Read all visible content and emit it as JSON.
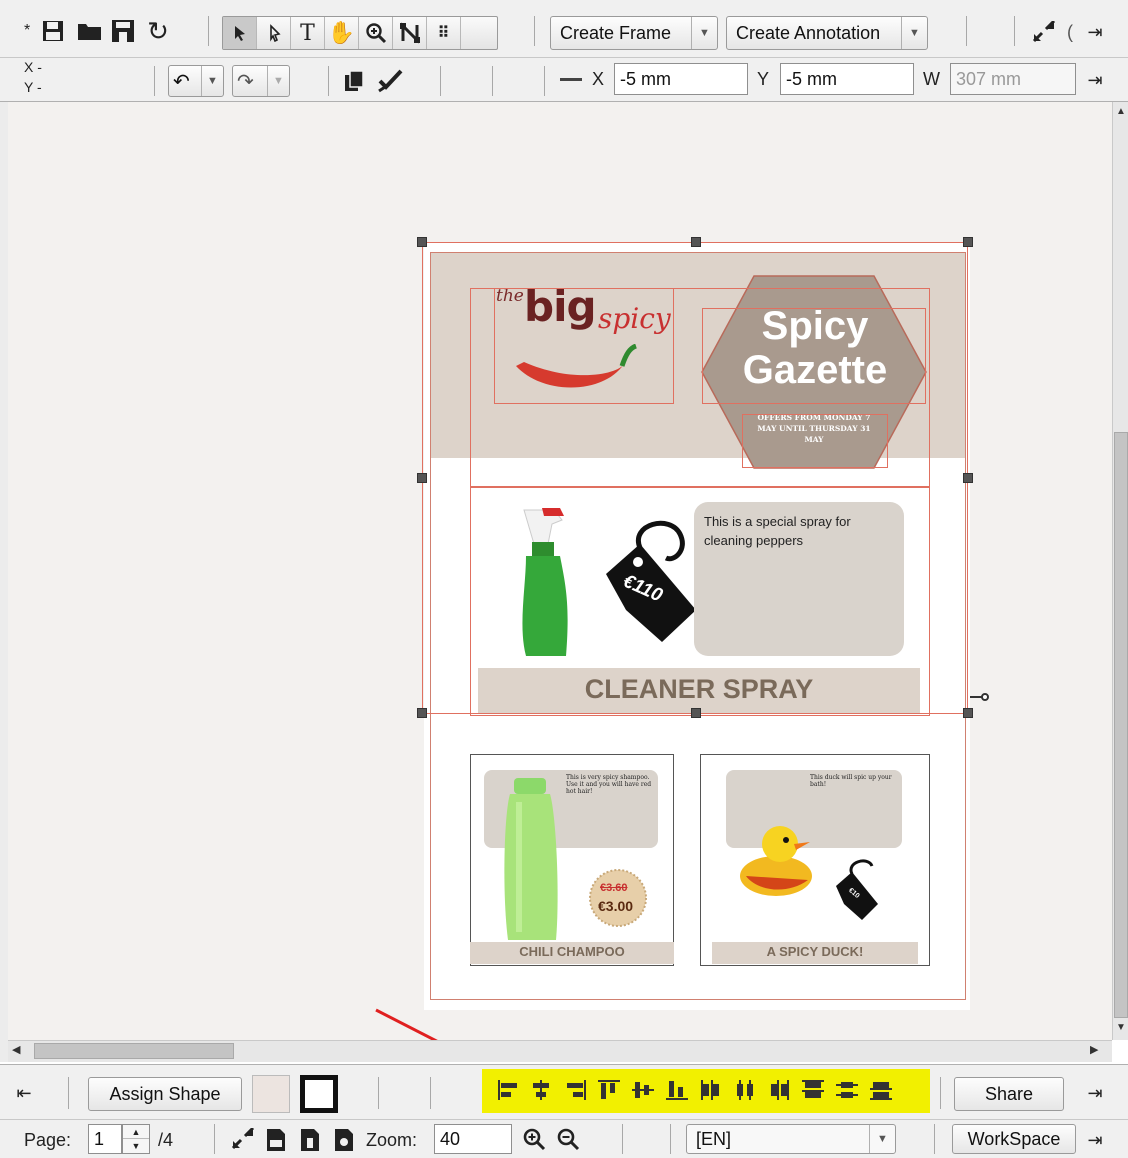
{
  "toolbar_top": {
    "modified_marker": "*",
    "create_frame_label": "Create Frame",
    "create_annotation_label": "Create Annotation"
  },
  "toolbar_props": {
    "x_readout": "X -",
    "y_readout": "Y -",
    "x_label": "X",
    "x_value": "-5 mm",
    "y_label": "Y",
    "y_value": "-5 mm",
    "w_label": "W",
    "w_value": "307 mm"
  },
  "document": {
    "logo_the": "the",
    "logo_big": "big",
    "logo_spicy": "spicy",
    "gazette_title_line1": "Spicy",
    "gazette_title_line2": "Gazette",
    "offer_text": "OFFERS FROM MONDAY 7 MAY UNTIL THURSDAY 31 MAY",
    "spray_description": "This is a special spray for cleaning peppers",
    "spray_price": "€110",
    "spray_caption": "CLEANER SPRAY",
    "shampoo_description": "This is very spicy shampoo. Use it and you will have red hot hair!",
    "shampoo_old_price": "€3.60",
    "shampoo_price": "€3.00",
    "shampoo_caption": "CHILI CHAMPOO",
    "duck_description": "This duck will spic up your bath!",
    "duck_price": "€10",
    "duck_caption": "A SPICY DUCK!"
  },
  "bottom_bar": {
    "assign_shape_label": "Assign Shape",
    "share_label": "Share"
  },
  "status_bar": {
    "page_label": "Page:",
    "page_value": "1",
    "page_total": "/4",
    "zoom_label": "Zoom:",
    "zoom_value": "40",
    "language_value": "[EN]",
    "workspace_label": "WorkSpace"
  },
  "colors": {
    "selection": "#e07060",
    "highlight": "#f2f000",
    "arrow": "#e02020",
    "caption_text": "#7a6a5a",
    "panel_grey": "#d9d3cc"
  }
}
